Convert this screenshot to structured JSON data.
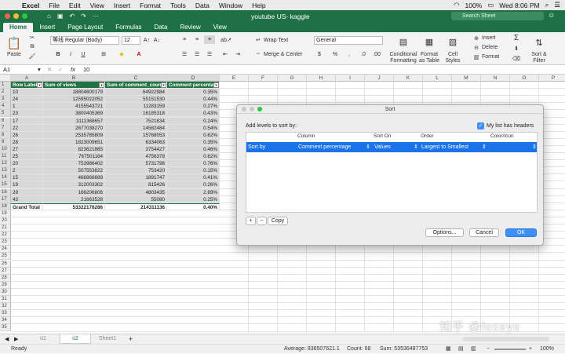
{
  "menubar": {
    "app": "Excel",
    "items": [
      "File",
      "Edit",
      "View",
      "Insert",
      "Format",
      "Tools",
      "Data",
      "Window",
      "Help"
    ],
    "battery": "100%",
    "clock": "Wed 8:06 PM"
  },
  "window": {
    "title": "youtube US- kaggle",
    "search_placeholder": "Search Sheet"
  },
  "ribbon": {
    "tabs": [
      "Home",
      "Insert",
      "Page Layout",
      "Formulas",
      "Data",
      "Review",
      "View"
    ],
    "paste_label": "Paste",
    "font_name": "等线 Regular (Body)",
    "font_size": "12",
    "bold": "B",
    "italic": "I",
    "underline": "U",
    "wrap_text": "Wrap Text",
    "merge_center": "Merge & Center",
    "number_format": "General",
    "percent": "%",
    "conditional_formatting": "Conditional Formatting",
    "format_as_table": "Format as Table",
    "cell_styles": "Cell Styles",
    "insert": "Insert",
    "delete": "Delete",
    "format": "Format",
    "sort_filter": "Sort & Filter"
  },
  "formula_bar": {
    "name_box": "A1",
    "fx": "fx",
    "value": "10"
  },
  "sheet": {
    "columns": [
      "A",
      "B",
      "C",
      "D",
      "E",
      "F",
      "G",
      "H",
      "I",
      "J",
      "K",
      "L",
      "M",
      "N",
      "O",
      "P"
    ],
    "header": [
      "Row Label",
      "Sum of views",
      "Sum of comment_count",
      "Comment percentage"
    ],
    "rows": [
      [
        "10",
        "18804600179",
        "64922984",
        "0.35%"
      ],
      [
        "24",
        "12595022052",
        "55151530",
        "0.44%"
      ],
      [
        "1",
        "4155543721",
        "11283159",
        "0.27%"
      ],
      [
        "23",
        "3800405369",
        "16185318",
        "0.43%"
      ],
      [
        "17",
        "3111368657",
        "7521834",
        "0.24%"
      ],
      [
        "22",
        "2677038270",
        "14582484",
        "0.54%"
      ],
      [
        "26",
        "2535785809",
        "15768053",
        "0.62%"
      ],
      [
        "28",
        "1823009651",
        "6334063",
        "0.35%"
      ],
      [
        "27",
        "823621865",
        "3754427",
        "0.46%"
      ],
      [
        "25",
        "767501164",
        "4756378",
        "0.62%"
      ],
      [
        "20",
        "753986402",
        "5731798",
        "0.76%"
      ],
      [
        "2",
        "507553822",
        "753420",
        "0.15%"
      ],
      [
        "15",
        "466866689",
        "1891747",
        "0.41%"
      ],
      [
        "19",
        "312003302",
        "815426",
        "0.26%"
      ],
      [
        "29",
        "166206806",
        "4803435",
        "2.89%"
      ],
      [
        "43",
        "21663528",
        "55080",
        "0.25%"
      ]
    ],
    "total": [
      "Grand Total",
      "53322176286",
      "214311136",
      "0.40%"
    ],
    "row_numbers": [
      "1",
      "2",
      "3",
      "4",
      "5",
      "6",
      "7",
      "8",
      "9",
      "10",
      "11",
      "12",
      "13",
      "14",
      "15",
      "16",
      "17",
      "18",
      "19",
      "20",
      "21",
      "22",
      "23",
      "24",
      "25",
      "26",
      "27",
      "28",
      "29",
      "30",
      "31",
      "32",
      "33",
      "34",
      "35"
    ]
  },
  "sheet_tabs": [
    "ü1",
    "ü2",
    "Sheet1"
  ],
  "add_sheet": "+",
  "status": {
    "ready": "Ready",
    "average": "Average: 836507621.1",
    "count": "Count: 68",
    "sum": "Sum: 53536487753",
    "zoom": "100%"
  },
  "sort_dialog": {
    "title": "Sort",
    "add_levels": "Add levels to sort by:",
    "has_headers": "My list has headers",
    "col_column": "Column",
    "col_sort_on": "Sort On",
    "col_order": "Order",
    "col_color": "Color/Icon",
    "row_label": "Sort by",
    "row_column": "Comment percentage",
    "row_sort_on": "Values",
    "row_order": "Largest to Smallest",
    "add_btn": "+",
    "remove_btn": "−",
    "copy_btn": "Copy",
    "options_btn": "Options...",
    "cancel_btn": "Cancel",
    "ok_btn": "OK"
  },
  "watermark": "知乎 @foxeye",
  "colors": {
    "accent": "#1e7145",
    "header_fill": "#217346",
    "selected_row": "#1a73e8"
  }
}
